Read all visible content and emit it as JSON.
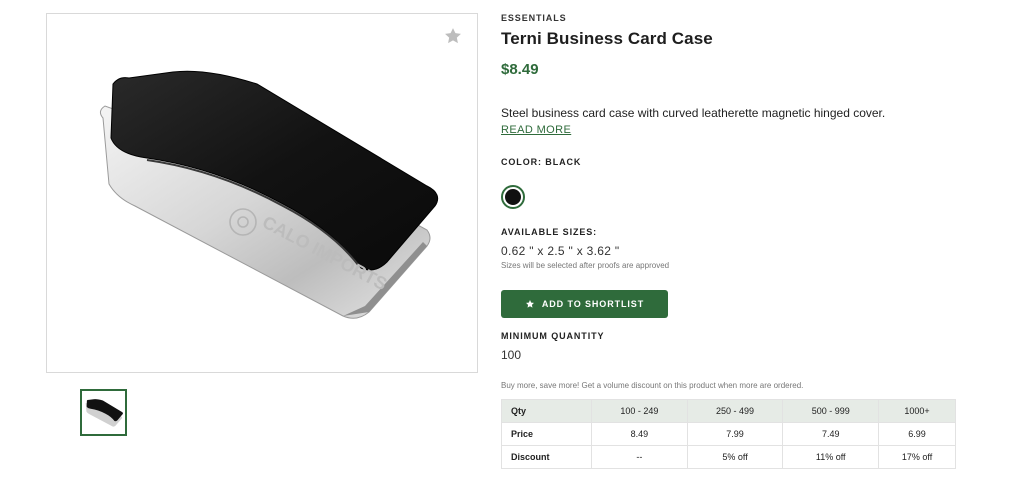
{
  "product": {
    "category": "ESSENTIALS",
    "title": "Terni Business Card Case",
    "price": "$8.49",
    "description": "Steel business card case with curved leatherette magnetic hinged cover.",
    "read_more": "READ MORE",
    "engraving_text": "CALO IMPORTS"
  },
  "color": {
    "label": "COLOR: BLACK",
    "swatches": [
      {
        "name": "Black",
        "hex": "#111111",
        "selected": true
      }
    ]
  },
  "sizes": {
    "label": "AVAILABLE SIZES:",
    "value": "0.62 \" x 2.5 \" x 3.62 \"",
    "note": "Sizes will be selected after proofs are approved"
  },
  "shortlist_button": {
    "label": "ADD TO SHORTLIST",
    "icon": "star-icon"
  },
  "minimum_quantity": {
    "label": "MINIMUM QUANTITY",
    "value": "100"
  },
  "volume_note": "Buy more, save more! Get a volume discount on this product when more are ordered.",
  "pricing_table": {
    "headers": [
      "Qty",
      "100 - 249",
      "250 - 499",
      "500 - 999",
      "1000+"
    ],
    "rows": [
      [
        "Price",
        "8.49",
        "7.99",
        "7.49",
        "6.99"
      ],
      [
        "Discount",
        "--",
        "5% off",
        "11% off",
        "17% off"
      ]
    ]
  },
  "icons": {
    "favorite": "star-icon"
  },
  "colors": {
    "accent": "#2f6b3b",
    "table_header_bg": "#e6ebe6"
  }
}
